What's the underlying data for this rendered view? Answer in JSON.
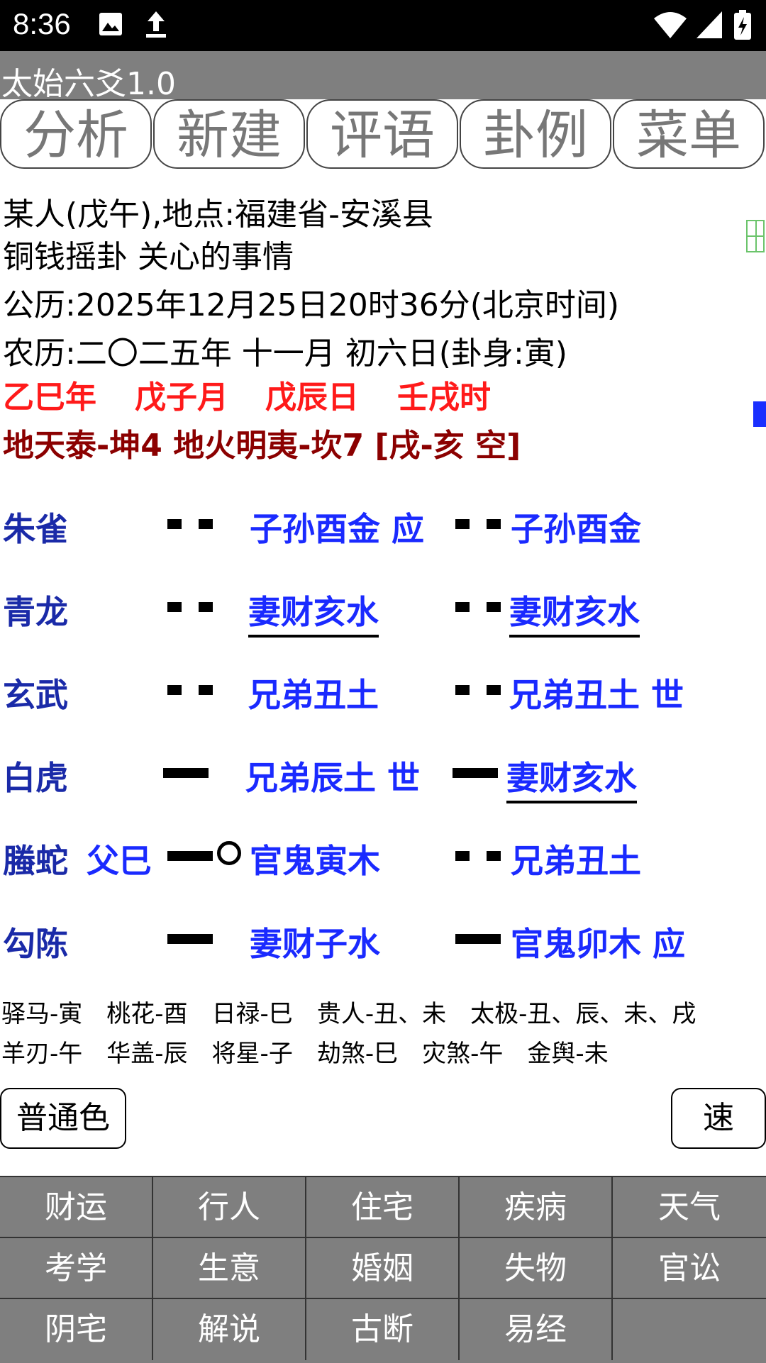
{
  "status_bar": {
    "time": "8:36"
  },
  "app": {
    "title": "太始六爻1.0"
  },
  "tabs": [
    "分析",
    "新建",
    "评语",
    "卦例",
    "菜单"
  ],
  "info": {
    "person": "某人(戊午),地点:福建省-安溪县",
    "method": "铜钱摇卦  关心的事情",
    "solar": "公历:2025年12月25日20时36分(北京时间)",
    "lunar": "农历:二〇二五年 十一月 初六日(卦身:寅)",
    "ganzhi": [
      "乙巳年",
      "戊子月",
      "戊辰日",
      "壬戌时"
    ],
    "hexagram": "地天泰-坤4  地火明夷-坎7 [戌-亥 空]"
  },
  "yao_rows": [
    {
      "god": "朱雀",
      "fuyao": "",
      "main_line": "yin",
      "moving": false,
      "main": "子孙酉金 应",
      "main_underline": false,
      "change_line": "yin",
      "change": "子孙酉金",
      "change_underline": false
    },
    {
      "god": "青龙",
      "fuyao": "",
      "main_line": "yin",
      "moving": false,
      "main": "妻财亥水",
      "main_underline": true,
      "change_line": "yin",
      "change": "妻财亥水",
      "change_underline": true
    },
    {
      "god": "玄武",
      "fuyao": "",
      "main_line": "yin",
      "moving": false,
      "main": "兄弟丑土",
      "main_underline": false,
      "change_line": "yin",
      "change": "兄弟丑土 世",
      "change_underline": false
    },
    {
      "god": "白虎",
      "fuyao": "",
      "main_line": "yang",
      "moving": false,
      "main": "兄弟辰土 世",
      "main_underline": false,
      "change_line": "yang",
      "change": "妻财亥水",
      "change_underline": true
    },
    {
      "god": "螣蛇",
      "fuyao": "父巳",
      "main_line": "yang",
      "moving": true,
      "main": "官鬼寅木",
      "main_underline": false,
      "change_line": "yin",
      "change": "兄弟丑土",
      "change_underline": false
    },
    {
      "god": "勾陈",
      "fuyao": "",
      "main_line": "yang",
      "moving": false,
      "main": "妻财子水",
      "main_underline": false,
      "change_line": "yang",
      "change": "官鬼卯木 应",
      "change_underline": false
    }
  ],
  "shensha": {
    "row1": [
      "驿马-寅",
      "桃花-酉",
      "日禄-巳",
      "贵人-丑、未",
      "太极-丑、辰、未、戌"
    ],
    "row2": [
      "羊刃-午",
      "华盖-辰",
      "将星-子",
      "劫煞-巳",
      "灾煞-午",
      "金舆-未"
    ]
  },
  "buttons": {
    "color": "普通色",
    "speed": "速"
  },
  "topics": [
    "财运",
    "行人",
    "住宅",
    "疾病",
    "天气",
    "考学",
    "生意",
    "婚姻",
    "失物",
    "官讼",
    "阴宅",
    "解说",
    "古断",
    "易经",
    ""
  ]
}
